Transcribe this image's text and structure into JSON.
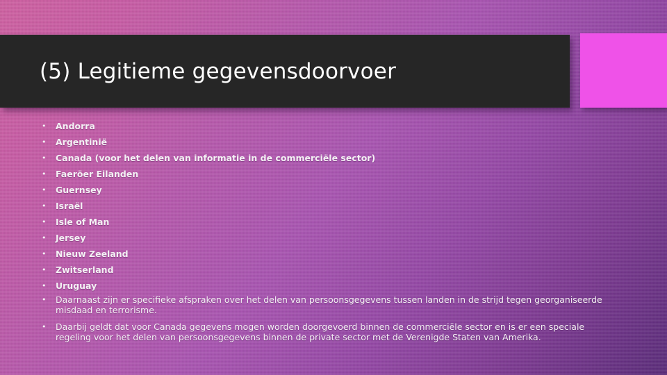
{
  "slide": {
    "title": "(5) Legitieme gegevensdoorvoer",
    "background_gradient_from": "#cd61a0",
    "background_gradient_to": "#5b2d7a",
    "title_bar_color": "#262626",
    "accent_block_color": "#ef52e8",
    "text_color": "#f4f0f4",
    "bullet_glyph": "•"
  },
  "body": {
    "items": [
      {
        "text": "Andorra",
        "style": "list"
      },
      {
        "text": "Argentinië",
        "style": "list"
      },
      {
        "text": "Canada (voor het delen van informatie in de commerciële sector)",
        "style": "list"
      },
      {
        "text": "Faeröer Eilanden",
        "style": "list"
      },
      {
        "text": "Guernsey",
        "style": "list"
      },
      {
        "text": "Israël",
        "style": "list"
      },
      {
        "text": "Isle of Man",
        "style": "list"
      },
      {
        "text": "Jersey",
        "style": "list"
      },
      {
        "text": "Nieuw Zeeland",
        "style": "list"
      },
      {
        "text": "Zwitserland",
        "style": "list"
      },
      {
        "text": "Uruguay",
        "style": "list"
      },
      {
        "text": "Daarnaast zijn er specifieke afspraken over het delen van persoonsgegevens tussen landen in de strijd tegen georganiseerde misdaad en terrorisme.",
        "style": "paragraph"
      },
      {
        "text": "Daarbij geldt dat voor Canada gegevens mogen worden doorgevoerd binnen de commerciële sector en is er een speciale regeling voor het delen van persoonsgegevens binnen de private sector met de Verenigde Staten van Amerika.",
        "style": "paragraph"
      }
    ]
  }
}
